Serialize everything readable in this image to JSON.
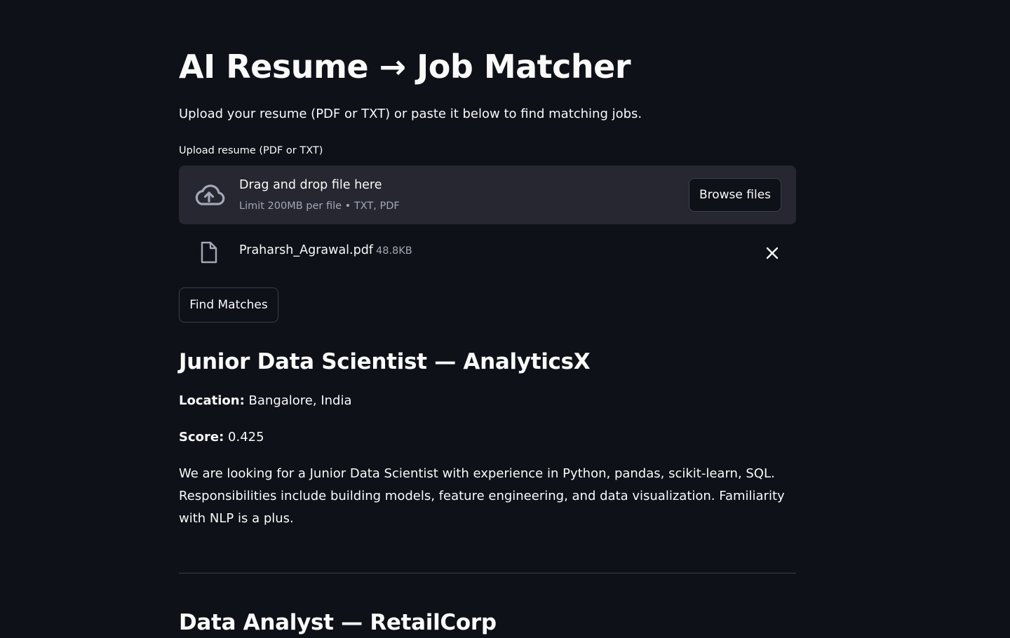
{
  "header": {
    "title": "AI Resume → Job Matcher",
    "subtitle": "Upload your resume (PDF or TXT) or paste it below to find matching jobs."
  },
  "uploader": {
    "label": "Upload resume (PDF or TXT)",
    "drop_title": "Drag and drop file here",
    "drop_limit": "Limit 200MB per file • TXT, PDF",
    "browse_label": "Browse files",
    "file_name": "Praharsh_Agrawal.pdf",
    "file_size": "48.8KB"
  },
  "actions": {
    "find_label": "Find Matches"
  },
  "jobs": [
    {
      "title": "Junior Data Scientist — AnalyticsX",
      "location_label": "Location:",
      "location": "Bangalore, India",
      "score_label": "Score:",
      "score": "0.425",
      "description": "We are looking for a Junior Data Scientist with experience in Python, pandas, scikit-learn, SQL. Responsibilities include building models, feature engineering, and data visualization. Familiarity with NLP is a plus."
    },
    {
      "title": "Data Analyst — RetailCorp"
    }
  ],
  "icons": {
    "upload": "cloud-upload-icon",
    "file": "file-icon",
    "remove": "close-icon"
  },
  "colors": {
    "background": "#0e1117",
    "surface": "#262730",
    "text": "#fafafa",
    "muted": "#a3a8b8",
    "border": "#3d404c"
  }
}
